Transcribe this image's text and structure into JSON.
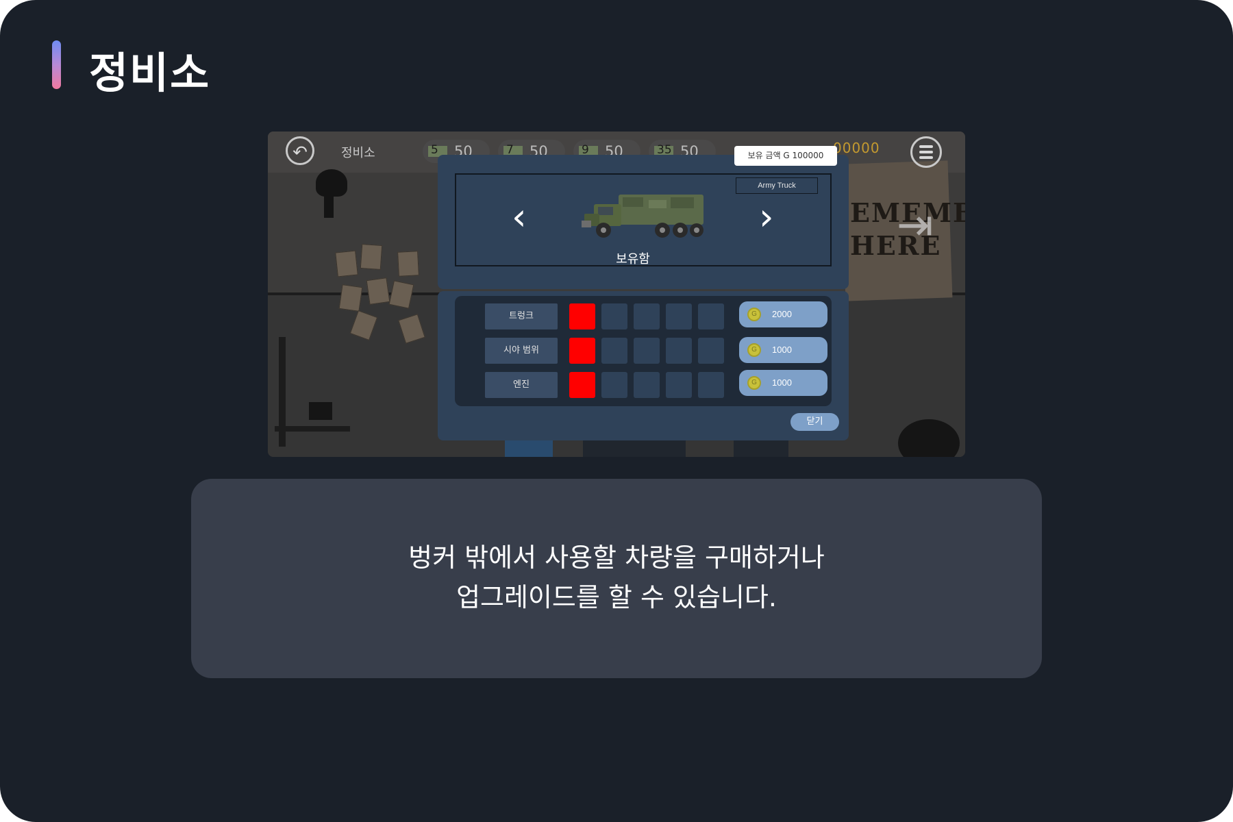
{
  "page": {
    "title": "정비소"
  },
  "game": {
    "hud": {
      "title": "정비소",
      "resources": [
        {
          "count": "5",
          "amount": "50"
        },
        {
          "count": "7",
          "amount": "50"
        },
        {
          "count": "9",
          "amount": "50"
        },
        {
          "count": "35",
          "amount": "50"
        }
      ],
      "gold": "00000"
    },
    "balance": "보유 금액 G 100000",
    "vehicle": {
      "name": "Army Truck",
      "status": "보유함"
    },
    "upgrades": [
      {
        "label": "트렁크",
        "level": 1,
        "max": 5,
        "cost": "2000"
      },
      {
        "label": "시야 범위",
        "level": 1,
        "max": 5,
        "cost": "1000"
      },
      {
        "label": "엔진",
        "level": 1,
        "max": 5,
        "cost": "1000"
      }
    ],
    "coin_symbol": "G",
    "close_label": "닫기",
    "background_banner": "EMEMBAY HERE",
    "colors": {
      "modal": "#2f4259",
      "filled_level": "#ff0000",
      "button": "#7ea0c8"
    }
  },
  "caption": {
    "line1": "벙커 밖에서 사용할 차량을 구매하거나",
    "line2": "업그레이드를 할 수 있습니다."
  }
}
